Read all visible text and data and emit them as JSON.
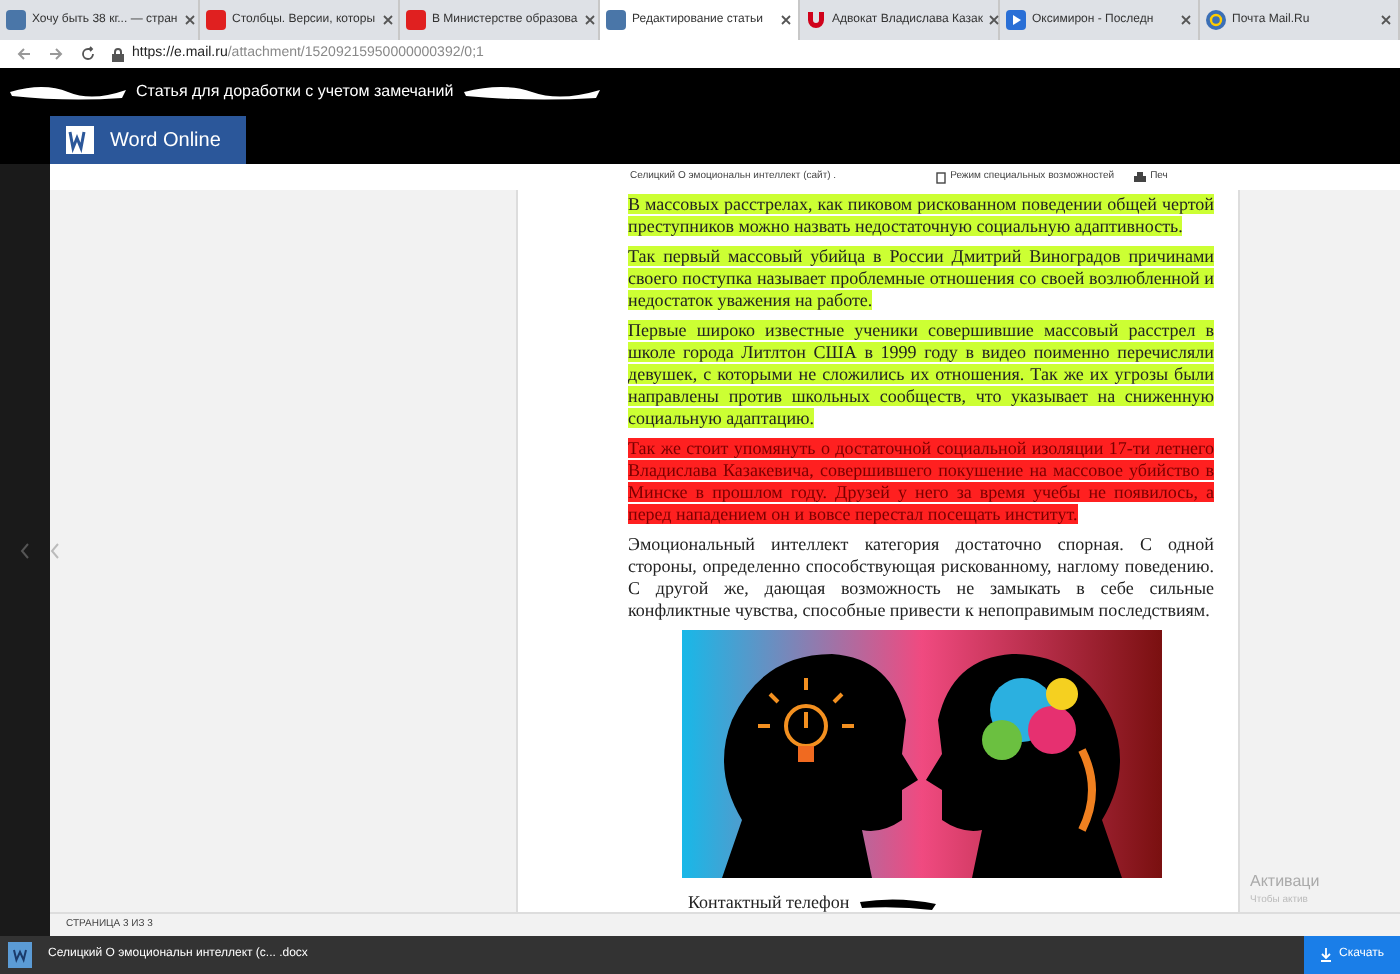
{
  "browser": {
    "tabs": [
      {
        "label": "Хочу быть 38 кг... — стран",
        "kind": "square",
        "selected": false
      },
      {
        "label": "Столбцы. Версии, которы",
        "kind": "alert",
        "selected": false
      },
      {
        "label": "В Министерстве образова",
        "kind": "alert",
        "selected": false
      },
      {
        "label": "Редактирование статьи",
        "kind": "square",
        "selected": true
      },
      {
        "label": "Адвокат Владислава Казак",
        "kind": "magnet",
        "selected": false
      },
      {
        "label": "Оксимирон - Последн",
        "kind": "play",
        "selected": false
      },
      {
        "label": "Почта Mail.Ru",
        "kind": "ring",
        "selected": false
      }
    ],
    "url_host": "https://e.mail.ru",
    "url_path": "/attachment/15209215950000000392/0;1"
  },
  "header": {
    "title": "Статья для доработки с учетом замечаний"
  },
  "app": {
    "name": "Word Online"
  },
  "toolbar": {
    "document_name": "Селицкий О эмоциональн интеллект (сайт) .",
    "accessibility": "Режим специальных возможностей",
    "print": "Печ"
  },
  "document": {
    "paragraphs": [
      {
        "kind": "green",
        "text": "В массовых расстрелах, как пиковом рискованном поведении общей чертой преступников можно назвать недостаточную социальную адаптивность."
      },
      {
        "kind": "green",
        "text": "Так первый массовый убийца в России Дмитрий Виноградов причинами своего поступка называет проблемные отношения со своей возлюбленной и недостаток уважения на работе."
      },
      {
        "kind": "green",
        "text": "Первые широко известные ученики совершившие массовый расстрел в школе города Литлтон США в 1999 году в видео поименно перечисляли девушек, с которыми не сложились их отношения. Так же их угрозы были направлены против школьных сообществ, что указывает на сниженную социальную адаптацию."
      },
      {
        "kind": "red",
        "text": "Так же стоит упомянуть о достаточной социальной изоляции 17-ти летнего Владислава Казакевича, совершившего покушение на массовое убийство в Минске в прошлом году. Друзей у него за время учебы не появилось, а перед нападением он и вовсе перестал посещать институт."
      },
      {
        "kind": "plain",
        "text": "Эмоциональный интеллект категория достаточно спорная. С одной стороны, определенно способствующая рискованному, наглому поведению. С другой же, дающая возможность не замыкать в себе сильные конфликтные чувства, способные привести к непоправимым последствиям."
      }
    ],
    "contact": "Контактный телефон"
  },
  "status": {
    "page": "СТРАНИЦА 3 ИЗ 3"
  },
  "activation": {
    "title": "Активаци",
    "subtitle": "Чтобы актив"
  },
  "downloads": {
    "file": "Селицкий О эмоциональн интеллект (с... .docx",
    "button": "Скачать"
  }
}
